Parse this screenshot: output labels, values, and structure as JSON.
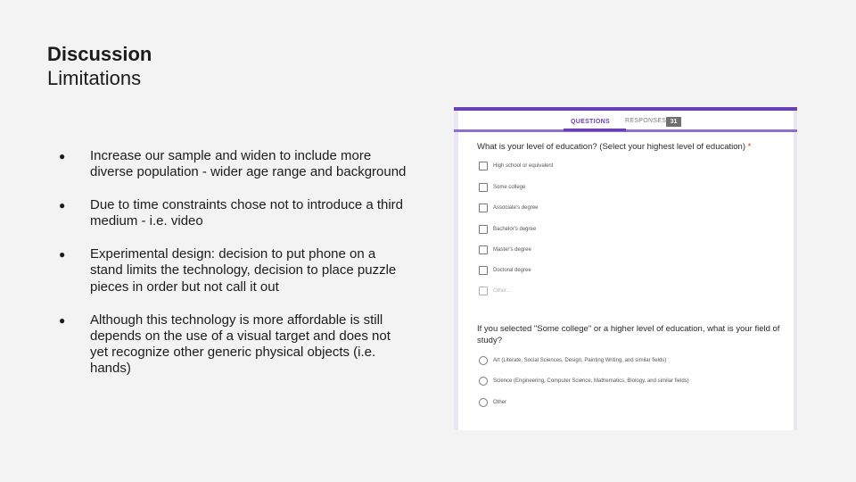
{
  "slide": {
    "title": "Discussion",
    "subtitle": "Limitations"
  },
  "bullets": [
    {
      "text": "Increase our sample and widen to include more diverse population - wider age range and background"
    },
    {
      "text": "Due to time constraints chose not to introduce a third medium - i.e. video"
    },
    {
      "text": "Experimental design: decision to put phone on a stand limits the technology, decision to place puzzle pieces in order but not call it out"
    },
    {
      "text": "Although this technology is more affordable is still depends on the use of a visual target and does not yet recognize other generic physical objects (i.e. hands)"
    }
  ],
  "bullet_char": "●",
  "form": {
    "tabs": {
      "questions": "QUESTIONS",
      "responses": "RESPONSES",
      "responses_count": "31"
    },
    "accent_color": "#6a3fb6",
    "q1": {
      "text": "What is your level of education? (Select your highest level of education)",
      "required_mark": "*",
      "options": [
        "High school or equivalent",
        "Some college",
        "Associate's degree",
        "Bachelor's degree",
        "Master's degree",
        "Doctoral degree",
        "Other..."
      ]
    },
    "q2": {
      "text": "If you selected \"Some college\" or a higher level of education, what is your field of study?",
      "options": [
        "Art (Literate, Social Sciences, Design, Painting Writing, and similar fields)",
        "Science (Engineering, Computer Science, Mathematics, Biology, and similar fields)",
        "Other"
      ]
    }
  }
}
